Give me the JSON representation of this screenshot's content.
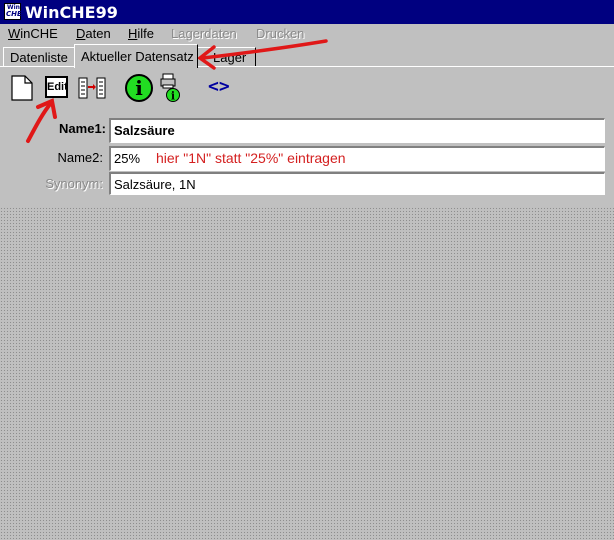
{
  "window": {
    "icon_text_top": "Win",
    "icon_text_bottom": "CHE",
    "title": "WinCHE99"
  },
  "menu": {
    "items": [
      {
        "pre": "",
        "ul": "W",
        "post": "inCHE",
        "disabled": false
      },
      {
        "pre": "",
        "ul": "D",
        "post": "aten",
        "disabled": false
      },
      {
        "pre": "",
        "ul": "H",
        "post": "ilfe",
        "disabled": false
      },
      {
        "pre": "Lagerdaten",
        "ul": "",
        "post": "",
        "disabled": true
      },
      {
        "pre": "Drucken",
        "ul": "",
        "post": "",
        "disabled": true
      }
    ]
  },
  "tabs": [
    {
      "label": "Datenliste",
      "active": false
    },
    {
      "label": "Aktueller Datensatz",
      "active": true
    },
    {
      "label": "Lager",
      "active": false
    }
  ],
  "toolbar": {
    "edit_label": "Edit",
    "info_label": "i",
    "nav_label": "<>",
    "icons": [
      "new-document-icon",
      "edit-icon",
      "list-transfer-icon",
      "info-icon",
      "print-info-icon",
      "navigate-icon"
    ]
  },
  "form": {
    "name1_label": "Name1:",
    "name1_value": "Salzsäure",
    "name2_label": "Name2:",
    "name2_value": "25%",
    "synonym_label": "Synonym:",
    "synonym_value": "Salzsäure, 1N"
  },
  "annotations": {
    "note": "hier \"1N\" statt \"25%\" eintragen",
    "color": "#d42020"
  },
  "colors": {
    "titlebar": "#000080",
    "face": "#c0c0c0",
    "info_green": "#22dd22",
    "annotation_red": "#e01818"
  }
}
